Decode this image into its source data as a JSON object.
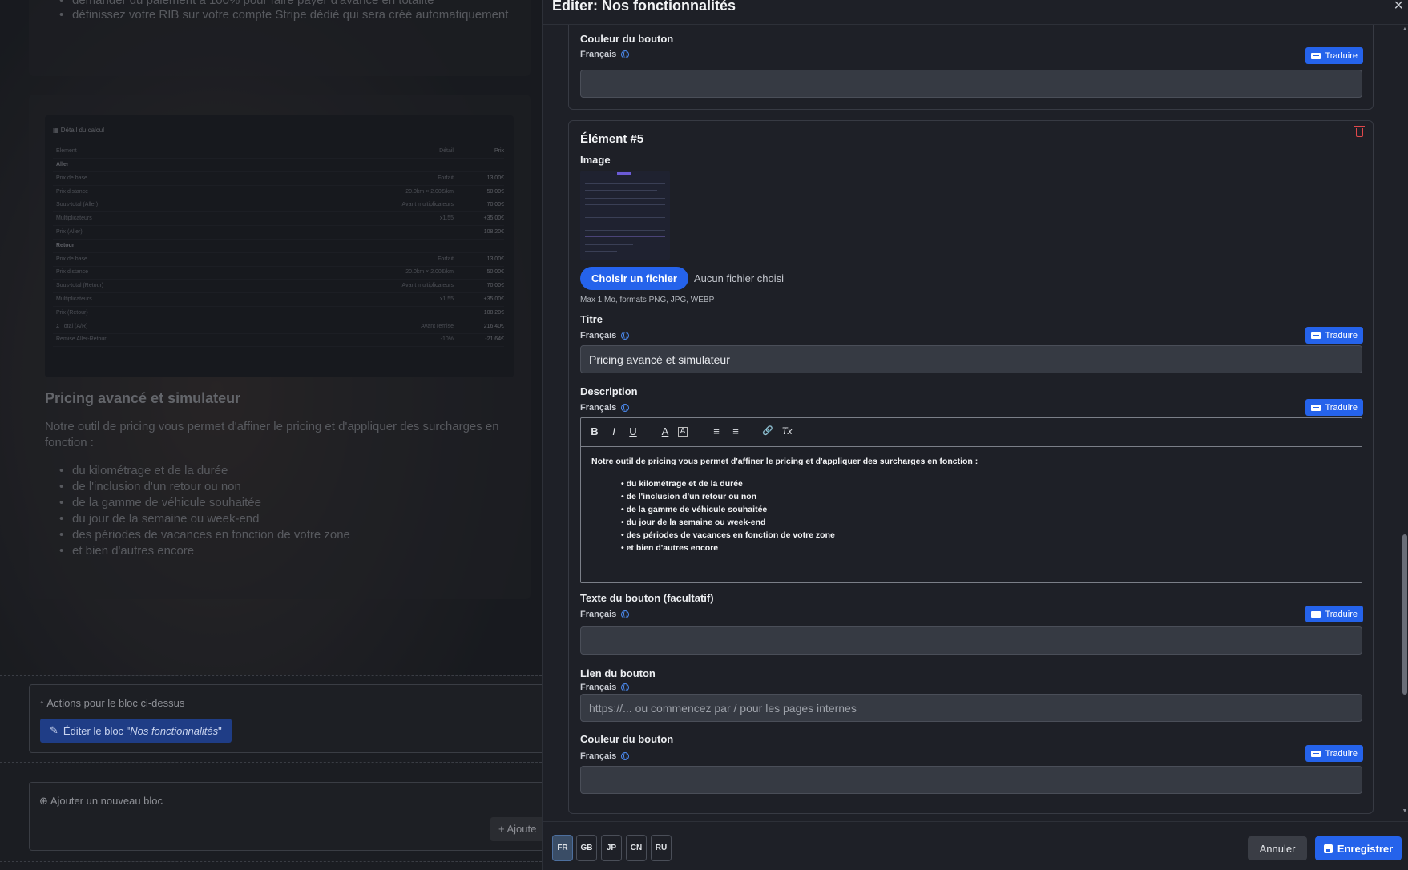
{
  "background": {
    "top_bullets": [
      "demander du paiement à 100% pour faire payer d'avance en totalité",
      "définissez votre RIB sur votre compte Stripe dédié qui sera créé automatiquement"
    ],
    "calc": {
      "title": "Détail du calcul",
      "headers": [
        "Élément",
        "Détail",
        "Prix"
      ],
      "rows": [
        {
          "label": "Aller",
          "detail": "",
          "price": "",
          "section": true
        },
        {
          "label": "Prix de base",
          "detail": "Forfait",
          "price": "13.00€"
        },
        {
          "label": "Prix distance",
          "detail": "20.0km × 2.00€/km",
          "price": "50.00€"
        },
        {
          "label": "Sous-total (Aller)",
          "detail": "Avant multiplicateurs",
          "price": "70.00€"
        },
        {
          "label": "Multiplicateurs",
          "detail": "x1.55",
          "price": "+35.00€"
        },
        {
          "label": "Prix (Aller)",
          "detail": "",
          "price": "108.20€"
        },
        {
          "label": "Retour",
          "detail": "",
          "price": "",
          "section": true
        },
        {
          "label": "Prix de base",
          "detail": "Forfait",
          "price": "13.00€"
        },
        {
          "label": "Prix distance",
          "detail": "20.0km × 2.00€/km",
          "price": "50.00€"
        },
        {
          "label": "Sous-total (Retour)",
          "detail": "Avant multiplicateurs",
          "price": "70.00€"
        },
        {
          "label": "Multiplicateurs",
          "detail": "x1.55",
          "price": "+35.00€"
        },
        {
          "label": "Prix (Retour)",
          "detail": "",
          "price": "108.20€"
        },
        {
          "label": "Σ Total (A/R)",
          "detail": "Avant remise",
          "price": "216.40€"
        },
        {
          "label": "Remise Aller-Retour",
          "detail": "-10%",
          "price": "-21.64€"
        }
      ]
    },
    "heading": "Pricing avancé et simulateur",
    "paragraph": "Notre outil de pricing vous permet d'affiner le pricing et d'appliquer des surcharges en fonction :",
    "bullets": [
      "du kilométrage et de la durée",
      "de l'inclusion d'un retour ou non",
      "de la gamme de véhicule souhaitée",
      "du jour de la semaine ou week-end",
      "des périodes de vacances en fonction de votre zone",
      "et bien d'autres encore"
    ],
    "actions_label": "Actions pour le bloc ci-dessus",
    "edit_prefix": "Éditer le bloc \"",
    "edit_block_name": "Nos fonctionnalités",
    "edit_suffix": "\"",
    "add_block_label": "Ajouter un nouveau bloc",
    "add_button": "Ajoute"
  },
  "modal": {
    "title": "Éditer: Nos fonctionnalités",
    "close": "×",
    "lang_name": "Français",
    "translate": "Traduire",
    "prev_button_color_label": "Couleur du bouton",
    "element": {
      "title": "Élément #5",
      "image_label": "Image",
      "choose_file": "Choisir un fichier",
      "no_file": "Aucun fichier choisi",
      "file_hint": "Max 1 Mo, formats PNG, JPG, WEBP",
      "title_label": "Titre",
      "title_value": "Pricing avancé et simulateur",
      "description_label": "Description",
      "toolbar": [
        "B",
        "I",
        "U",
        "A",
        "A",
        "≡",
        "≡",
        "🔗",
        "Tx"
      ],
      "description_text": "Notre outil de pricing vous permet d'affiner le pricing et d'appliquer des surcharges en fonction :",
      "description_bullets": [
        "du kilométrage et de la durée",
        "de l'inclusion d'un retour ou non",
        "de la gamme de véhicule souhaitée",
        "du jour de la semaine ou week-end",
        "des périodes de vacances en fonction de votre zone",
        "et bien d'autres encore"
      ],
      "button_text_label": "Texte du bouton (facultatif)",
      "button_link_label": "Lien du bouton",
      "button_link_placeholder": "https://... ou commencez par / pour les pages internes",
      "button_color_label": "Couleur du bouton"
    },
    "footer": {
      "langs": [
        "FR",
        "GB",
        "JP",
        "CN",
        "RU"
      ],
      "active_lang": "FR",
      "cancel": "Annuler",
      "save": "Enregistrer"
    }
  },
  "colors": {
    "accent": "#2563eb",
    "danger": "#e0484b"
  }
}
